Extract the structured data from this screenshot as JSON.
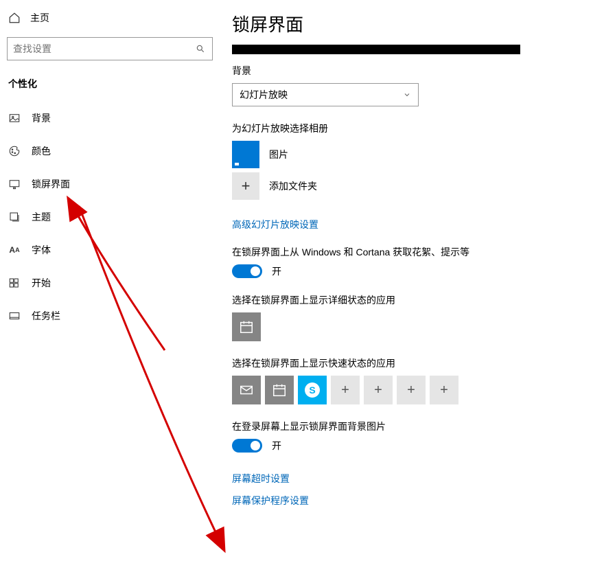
{
  "home_label": "主页",
  "search": {
    "placeholder": "查找设置"
  },
  "category_title": "个性化",
  "nav": {
    "background": "背景",
    "colors": "颜色",
    "lockscreen": "锁屏界面",
    "themes": "主题",
    "fonts": "字体",
    "start": "开始",
    "taskbar": "任务栏"
  },
  "page": {
    "title": "锁屏界面",
    "background_label": "背景",
    "background_value": "幻灯片放映",
    "album_section": "为幻灯片放映选择相册",
    "album_pictures": "图片",
    "album_add": "添加文件夹",
    "advanced_link": "高级幻灯片放映设置",
    "tidbits_label": "在锁屏界面上从 Windows 和 Cortana 获取花絮、提示等",
    "toggle_on": "开",
    "detailed_label": "选择在锁屏界面上显示详细状态的应用",
    "quick_label": "选择在锁屏界面上显示快速状态的应用",
    "signin_bg_label": "在登录屏幕上显示锁屏界面背景图片",
    "timeout_link": "屏幕超时设置",
    "screensaver_link": "屏幕保护程序设置"
  }
}
